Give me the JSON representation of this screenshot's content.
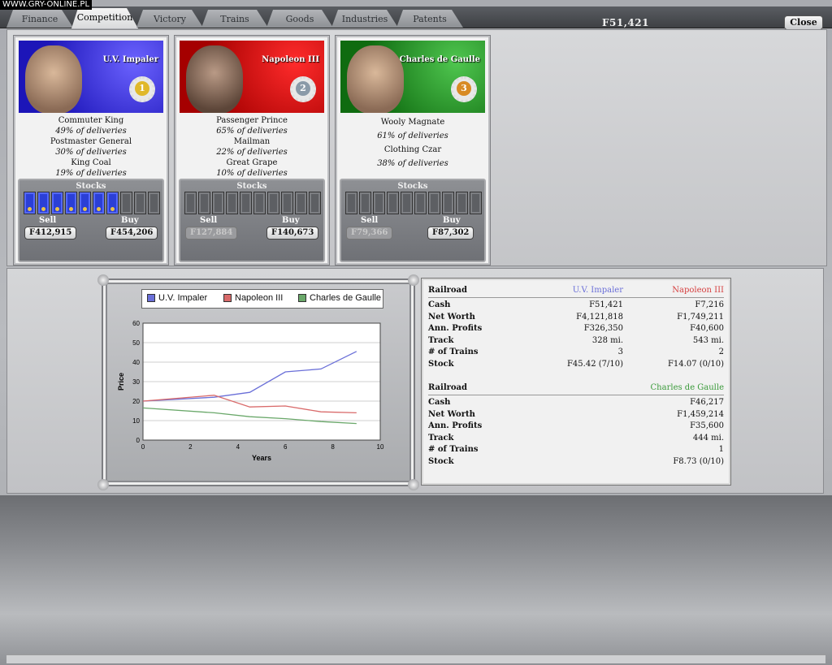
{
  "watermark": "WWW.GRY-ONLINE.PL",
  "tabs": [
    "Finance",
    "Competition",
    "Victory",
    "Trains",
    "Goods",
    "Industries",
    "Patents"
  ],
  "active_tab": "Competition",
  "cash_top": "F51,421",
  "close_label": "Close",
  "stocks_label": "Stocks",
  "sell_label": "Sell",
  "buy_label": "Buy",
  "players": [
    {
      "name": "U.V. Impaler",
      "color": "#2b3fd6",
      "rank": "1",
      "titles": [
        [
          "Commuter King",
          "49% of deliveries"
        ],
        [
          "Postmaster General",
          "30% of deliveries"
        ],
        [
          "King Coal",
          "19% of deliveries"
        ]
      ],
      "shares_owned": 7,
      "shares_total": 10,
      "sell": "F412,915",
      "buy": "F454,206",
      "sell_disabled": false
    },
    {
      "name": "Napoleon  III",
      "color": "#d62b2b",
      "rank": "2",
      "titles": [
        [
          "Passenger Prince",
          "65% of deliveries"
        ],
        [
          "Mailman",
          "22% of deliveries"
        ],
        [
          "Great Grape",
          "10% of deliveries"
        ]
      ],
      "shares_owned": 0,
      "shares_total": 10,
      "sell": "F127,884",
      "buy": "F140,673",
      "sell_disabled": true
    },
    {
      "name": "Charles de Gaulle",
      "color": "#2e9a2e",
      "rank": "3",
      "titles": [
        [
          "Wooly Magnate",
          "61% of deliveries"
        ],
        [
          "Clothing Czar",
          "38% of deliveries"
        ]
      ],
      "shares_owned": 0,
      "shares_total": 10,
      "sell": "F79,366",
      "buy": "F87,302",
      "sell_disabled": true
    }
  ],
  "chart_data": {
    "type": "line",
    "xlabel": "Years",
    "ylabel": "Price",
    "xlim": [
      0,
      10
    ],
    "ylim": [
      0,
      60
    ],
    "xticks": [
      0,
      2,
      4,
      6,
      8,
      10
    ],
    "yticks": [
      0,
      10,
      20,
      30,
      40,
      50,
      60
    ],
    "grid": true,
    "legend": "top",
    "series": [
      {
        "name": "U.V. Impaler",
        "color": "#6a6fd8",
        "x": [
          0,
          3,
          4.5,
          6,
          7.5,
          9
        ],
        "y": [
          20,
          22,
          24.5,
          35,
          36.5,
          45.5
        ]
      },
      {
        "name": "Napoleon  III",
        "color": "#d96a6a",
        "x": [
          0,
          3,
          4.5,
          6,
          7.5,
          9
        ],
        "y": [
          20,
          23,
          17,
          17.5,
          14.5,
          14
        ]
      },
      {
        "name": "Charles de Gaulle",
        "color": "#6aa86a",
        "x": [
          0,
          3,
          4.5,
          6,
          7.5,
          9
        ],
        "y": [
          16.5,
          14,
          12,
          11,
          9.5,
          8.5
        ]
      }
    ]
  },
  "stats_top": {
    "header": "Railroad",
    "col1": "U.V. Impaler",
    "col2": "Napoleon  III",
    "col1_color": "#6a6fd8",
    "col2_color": "#d64040",
    "rows": [
      [
        "Cash",
        "F51,421",
        "F7,216"
      ],
      [
        "Net Worth",
        "F4,121,818",
        "F1,749,211"
      ],
      [
        "Ann. Profits",
        "F326,350",
        "F40,600"
      ],
      [
        "Track",
        "328 mi.",
        "543 mi."
      ],
      [
        "# of Trains",
        "3",
        "2"
      ],
      [
        "Stock",
        "F45.42 (7/10)",
        "F14.07 (0/10)"
      ]
    ]
  },
  "stats_bottom": {
    "header": "Railroad",
    "col2": "Charles de Gaulle",
    "col2_color": "#3a9a3a",
    "rows": [
      [
        "Cash",
        "F46,217"
      ],
      [
        "Net Worth",
        "F1,459,214"
      ],
      [
        "Ann. Profits",
        "F35,600"
      ],
      [
        "Track",
        "444 mi."
      ],
      [
        "# of Trains",
        "1"
      ],
      [
        "Stock",
        "F8.73 (0/10)"
      ]
    ]
  }
}
